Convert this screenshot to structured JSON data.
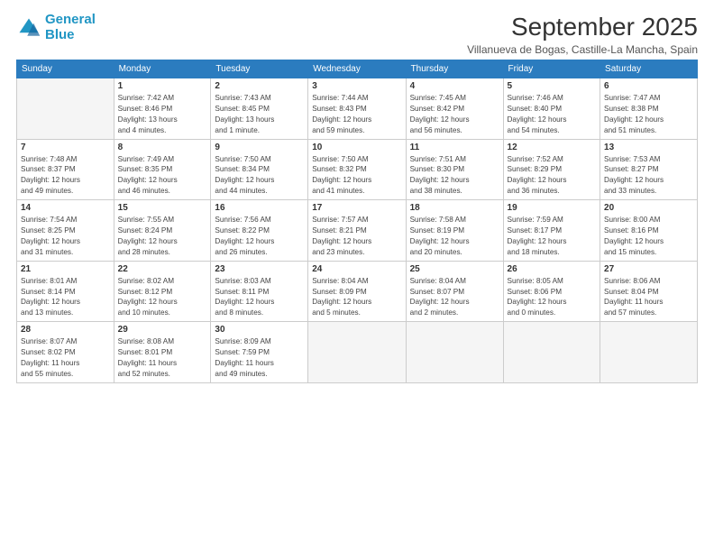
{
  "logo": {
    "line1": "General",
    "line2": "Blue"
  },
  "title": "September 2025",
  "subtitle": "Villanueva de Bogas, Castille-La Mancha, Spain",
  "weekdays": [
    "Sunday",
    "Monday",
    "Tuesday",
    "Wednesday",
    "Thursday",
    "Friday",
    "Saturday"
  ],
  "weeks": [
    [
      {
        "day": "",
        "info": ""
      },
      {
        "day": "1",
        "info": "Sunrise: 7:42 AM\nSunset: 8:46 PM\nDaylight: 13 hours\nand 4 minutes."
      },
      {
        "day": "2",
        "info": "Sunrise: 7:43 AM\nSunset: 8:45 PM\nDaylight: 13 hours\nand 1 minute."
      },
      {
        "day": "3",
        "info": "Sunrise: 7:44 AM\nSunset: 8:43 PM\nDaylight: 12 hours\nand 59 minutes."
      },
      {
        "day": "4",
        "info": "Sunrise: 7:45 AM\nSunset: 8:42 PM\nDaylight: 12 hours\nand 56 minutes."
      },
      {
        "day": "5",
        "info": "Sunrise: 7:46 AM\nSunset: 8:40 PM\nDaylight: 12 hours\nand 54 minutes."
      },
      {
        "day": "6",
        "info": "Sunrise: 7:47 AM\nSunset: 8:38 PM\nDaylight: 12 hours\nand 51 minutes."
      }
    ],
    [
      {
        "day": "7",
        "info": "Sunrise: 7:48 AM\nSunset: 8:37 PM\nDaylight: 12 hours\nand 49 minutes."
      },
      {
        "day": "8",
        "info": "Sunrise: 7:49 AM\nSunset: 8:35 PM\nDaylight: 12 hours\nand 46 minutes."
      },
      {
        "day": "9",
        "info": "Sunrise: 7:50 AM\nSunset: 8:34 PM\nDaylight: 12 hours\nand 44 minutes."
      },
      {
        "day": "10",
        "info": "Sunrise: 7:50 AM\nSunset: 8:32 PM\nDaylight: 12 hours\nand 41 minutes."
      },
      {
        "day": "11",
        "info": "Sunrise: 7:51 AM\nSunset: 8:30 PM\nDaylight: 12 hours\nand 38 minutes."
      },
      {
        "day": "12",
        "info": "Sunrise: 7:52 AM\nSunset: 8:29 PM\nDaylight: 12 hours\nand 36 minutes."
      },
      {
        "day": "13",
        "info": "Sunrise: 7:53 AM\nSunset: 8:27 PM\nDaylight: 12 hours\nand 33 minutes."
      }
    ],
    [
      {
        "day": "14",
        "info": "Sunrise: 7:54 AM\nSunset: 8:25 PM\nDaylight: 12 hours\nand 31 minutes."
      },
      {
        "day": "15",
        "info": "Sunrise: 7:55 AM\nSunset: 8:24 PM\nDaylight: 12 hours\nand 28 minutes."
      },
      {
        "day": "16",
        "info": "Sunrise: 7:56 AM\nSunset: 8:22 PM\nDaylight: 12 hours\nand 26 minutes."
      },
      {
        "day": "17",
        "info": "Sunrise: 7:57 AM\nSunset: 8:21 PM\nDaylight: 12 hours\nand 23 minutes."
      },
      {
        "day": "18",
        "info": "Sunrise: 7:58 AM\nSunset: 8:19 PM\nDaylight: 12 hours\nand 20 minutes."
      },
      {
        "day": "19",
        "info": "Sunrise: 7:59 AM\nSunset: 8:17 PM\nDaylight: 12 hours\nand 18 minutes."
      },
      {
        "day": "20",
        "info": "Sunrise: 8:00 AM\nSunset: 8:16 PM\nDaylight: 12 hours\nand 15 minutes."
      }
    ],
    [
      {
        "day": "21",
        "info": "Sunrise: 8:01 AM\nSunset: 8:14 PM\nDaylight: 12 hours\nand 13 minutes."
      },
      {
        "day": "22",
        "info": "Sunrise: 8:02 AM\nSunset: 8:12 PM\nDaylight: 12 hours\nand 10 minutes."
      },
      {
        "day": "23",
        "info": "Sunrise: 8:03 AM\nSunset: 8:11 PM\nDaylight: 12 hours\nand 8 minutes."
      },
      {
        "day": "24",
        "info": "Sunrise: 8:04 AM\nSunset: 8:09 PM\nDaylight: 12 hours\nand 5 minutes."
      },
      {
        "day": "25",
        "info": "Sunrise: 8:04 AM\nSunset: 8:07 PM\nDaylight: 12 hours\nand 2 minutes."
      },
      {
        "day": "26",
        "info": "Sunrise: 8:05 AM\nSunset: 8:06 PM\nDaylight: 12 hours\nand 0 minutes."
      },
      {
        "day": "27",
        "info": "Sunrise: 8:06 AM\nSunset: 8:04 PM\nDaylight: 11 hours\nand 57 minutes."
      }
    ],
    [
      {
        "day": "28",
        "info": "Sunrise: 8:07 AM\nSunset: 8:02 PM\nDaylight: 11 hours\nand 55 minutes."
      },
      {
        "day": "29",
        "info": "Sunrise: 8:08 AM\nSunset: 8:01 PM\nDaylight: 11 hours\nand 52 minutes."
      },
      {
        "day": "30",
        "info": "Sunrise: 8:09 AM\nSunset: 7:59 PM\nDaylight: 11 hours\nand 49 minutes."
      },
      {
        "day": "",
        "info": ""
      },
      {
        "day": "",
        "info": ""
      },
      {
        "day": "",
        "info": ""
      },
      {
        "day": "",
        "info": ""
      }
    ]
  ]
}
